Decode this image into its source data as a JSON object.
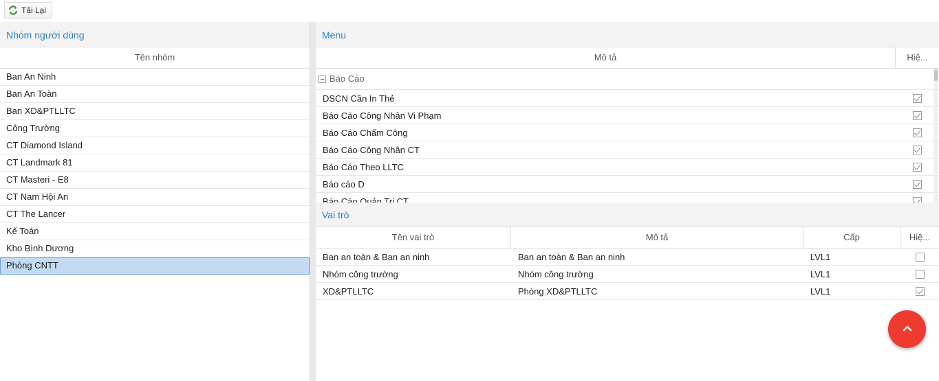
{
  "toolbar": {
    "reload_label": "Tải Lại"
  },
  "groups_panel": {
    "title": "Nhóm người dùng",
    "column_header": "Tên nhóm",
    "rows": [
      "Ban An Ninh",
      "Ban An Toàn",
      "Ban XD&PTLLTC",
      "Công Trường",
      "CT Diamond Island",
      "CT Landmark 81",
      "CT Masteri - E8",
      "CT Nam Hội An",
      "CT The Lancer",
      "Kế Toán",
      "Kho Bình Dương",
      "Phòng CNTT"
    ],
    "selected": "Phòng CNTT"
  },
  "menu_panel": {
    "title": "Menu",
    "columns": {
      "description": "Mô tả",
      "visible": "Hiệ..."
    },
    "group_label": "Báo Cáo",
    "rows": [
      {
        "label": "DSCN Cần In Thẻ",
        "checked": true
      },
      {
        "label": "Báo Cáo Công Nhân Vi Phạm",
        "checked": true
      },
      {
        "label": "Báo Cáo Chấm Công",
        "checked": true
      },
      {
        "label": "Báo Cáo Công Nhân CT",
        "checked": true
      },
      {
        "label": "Báo Cáo Theo LLTC",
        "checked": true
      },
      {
        "label": "Báo cáo D",
        "checked": true
      },
      {
        "label": "Báo Cáo Quản Trị CT",
        "checked": true
      }
    ]
  },
  "roles_panel": {
    "title": "Vai trò",
    "columns": {
      "name": "Tên vai trò",
      "description": "Mô tả",
      "level": "Cấp",
      "visible": "Hiệ..."
    },
    "rows": [
      {
        "name": "Ban an toàn & Ban an ninh",
        "description": "Ban an toàn & Ban an ninh",
        "level": "LVL1",
        "checked": false
      },
      {
        "name": "Nhóm công trường",
        "description": "Nhóm công trường",
        "level": "LVL1",
        "checked": false
      },
      {
        "name": "XD&PTLLTC",
        "description": "Phòng XD&PTLLTC",
        "level": "LVL1",
        "checked": true
      }
    ]
  },
  "colors": {
    "accent": "#2a7fc6",
    "selected_row": "#c3dbf2",
    "fab": "#ef3a2f"
  },
  "icons": {
    "reload": "refresh-icon",
    "fab": "chevron-up-icon",
    "group_toggle": "collapse-icon"
  }
}
